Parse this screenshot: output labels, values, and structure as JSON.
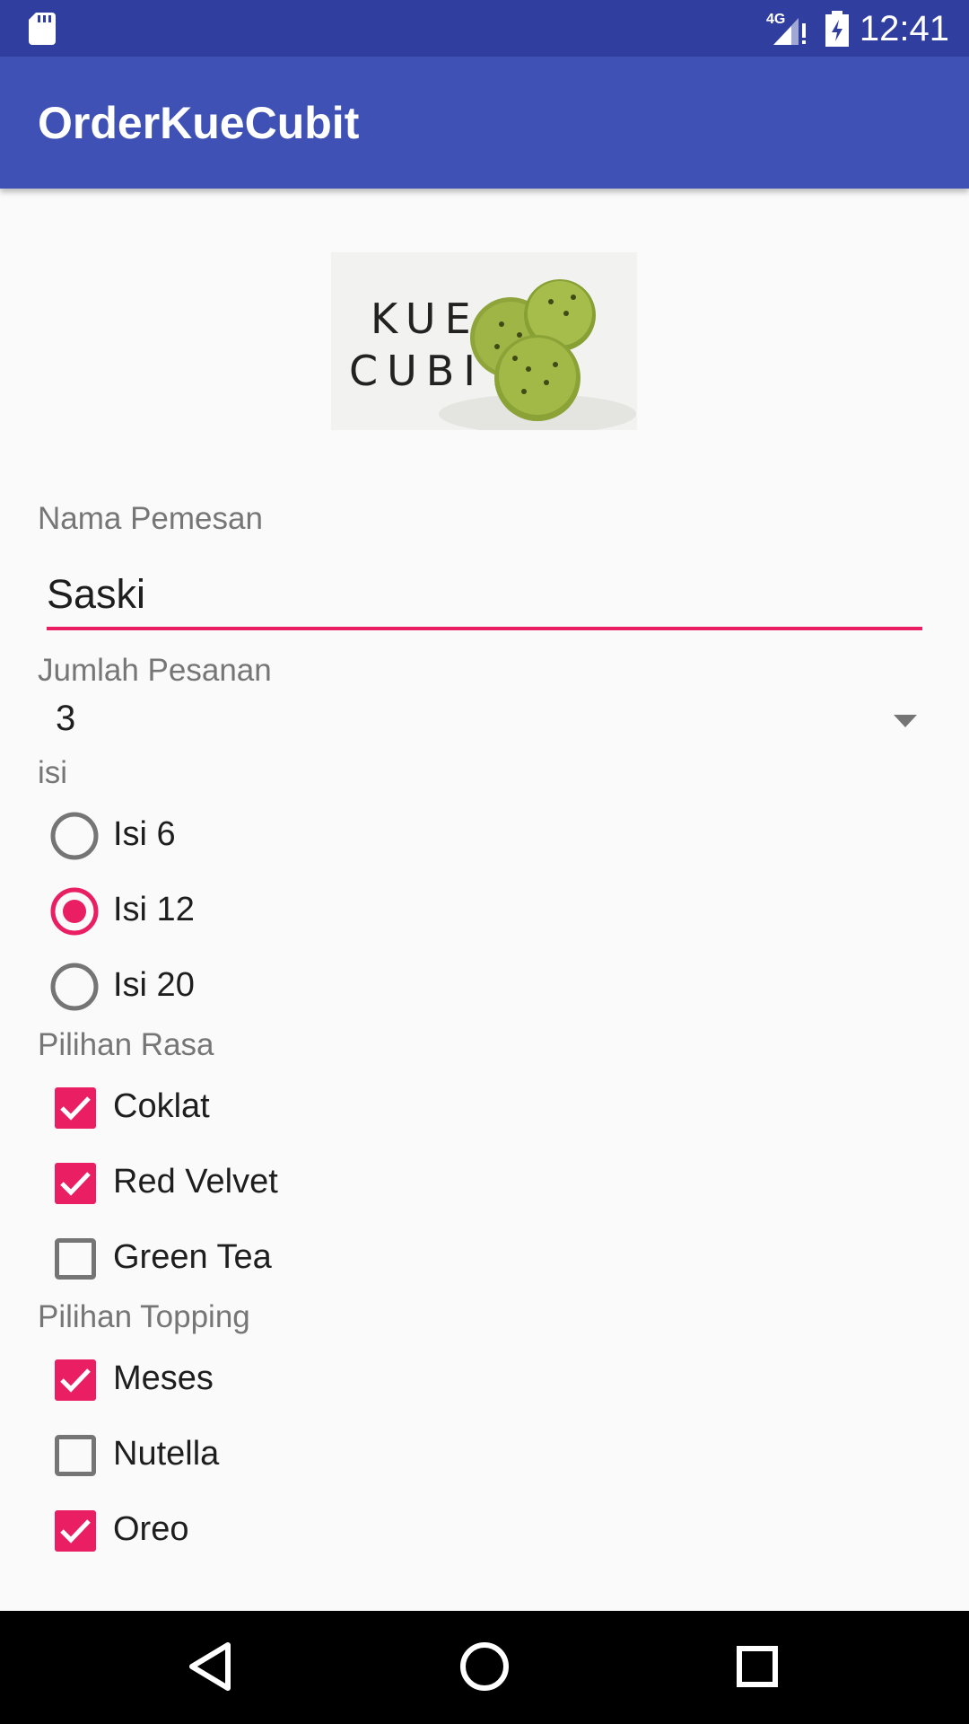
{
  "status_bar": {
    "network": "4G",
    "time": "12:41",
    "icons": [
      "sd-card-icon",
      "signal-icon",
      "battery-icon"
    ]
  },
  "app_bar": {
    "title": "OrderKueCubit"
  },
  "hero_image": {
    "text_line1": "KUE",
    "text_line2": "CUBIT"
  },
  "form": {
    "name_label": "Nama Pemesan",
    "name_value": "Saski",
    "qty_label": "Jumlah Pesanan",
    "qty_value": "3",
    "isi_label": "isi",
    "isi_options": [
      {
        "label": "Isi 6",
        "selected": false
      },
      {
        "label": "Isi 12",
        "selected": true
      },
      {
        "label": "Isi 20",
        "selected": false
      }
    ],
    "rasa_label": "Pilihan Rasa",
    "rasa_options": [
      {
        "label": "Coklat",
        "checked": true
      },
      {
        "label": "Red Velvet",
        "checked": true
      },
      {
        "label": "Green Tea",
        "checked": false
      }
    ],
    "topping_label": "Pilihan Topping",
    "topping_options": [
      {
        "label": "Meses",
        "checked": true
      },
      {
        "label": "Nutella",
        "checked": false
      },
      {
        "label": "Oreo",
        "checked": true
      }
    ]
  },
  "nav_bar": {
    "icons": [
      "back-icon",
      "home-icon",
      "recents-icon"
    ]
  },
  "colors": {
    "primary": "#3f51b5",
    "primary_dark": "#303f9f",
    "accent": "#e91e63",
    "control_gray": "#757575"
  }
}
